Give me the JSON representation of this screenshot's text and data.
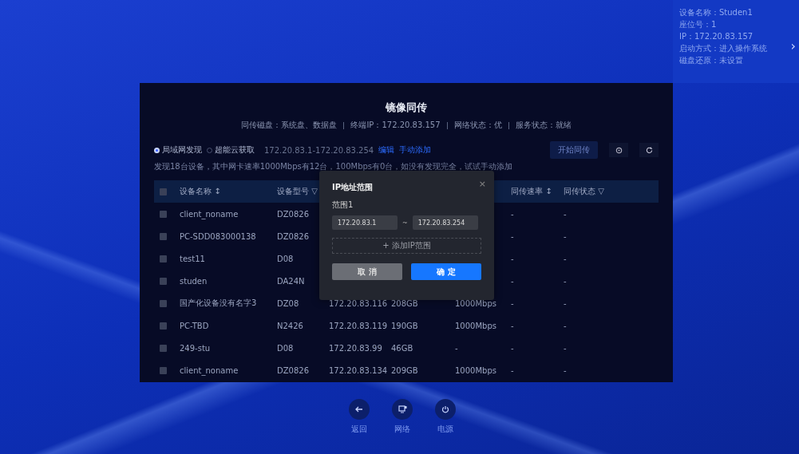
{
  "device_info": {
    "lines": [
      "设备名称：Studen1",
      "座位号：1",
      "IP：172.20.83.157",
      "启动方式：进入操作系统",
      "磁盘还原：未设置"
    ],
    "expand": "›"
  },
  "panel": {
    "title": "镜像同传",
    "status_items": [
      "同传磁盘：系统盘、数据盘",
      "终端IP：172.20.83.157",
      "网络状态：优",
      "服务状态：就绪"
    ],
    "sources": [
      {
        "label": "局域网发现",
        "selected": true
      },
      {
        "label": "超能云获取",
        "selected": false
      }
    ],
    "range": "172.20.83.1-172.20.83.254",
    "links": [
      "编辑",
      "手动添加"
    ],
    "start_button": {
      "label": "开始同传",
      "disabled": true
    },
    "summary": "发现18台设备，其中网卡速率1000Mbps有12台，100Mbps有0台，如没有发现完全，试试手动添加"
  },
  "table": {
    "header_checked": false,
    "columns": [
      {
        "label": "设备名称 ↕"
      },
      {
        "label": "设备型号 ▽"
      },
      {},
      {},
      {},
      {
        "label": "同传速率 ↕"
      },
      {
        "label": "同传状态 ▽"
      }
    ],
    "rows": [
      {
        "checked": false,
        "cells": [
          "client_noname",
          "DZ0826",
          null,
          null,
          null,
          "-",
          "-"
        ]
      },
      {
        "checked": false,
        "cells": [
          "PC-SDD083000138",
          "DZ0826",
          null,
          null,
          null,
          "-",
          "-"
        ]
      },
      {
        "checked": false,
        "cells": [
          "test11",
          "D08",
          null,
          null,
          null,
          "-",
          "-"
        ]
      },
      {
        "checked": false,
        "cells": [
          "studen",
          "DA24N",
          null,
          null,
          null,
          "-",
          "-"
        ]
      },
      {
        "checked": false,
        "cells": [
          "国产化设备没有名字3",
          "DZ08",
          "172.20.83.116",
          "208GB",
          "1000Mbps",
          "-",
          "-"
        ]
      },
      {
        "checked": false,
        "cells": [
          "PC-TBD",
          "N2426",
          "172.20.83.119",
          "190GB",
          "1000Mbps",
          "-",
          "-"
        ]
      },
      {
        "checked": false,
        "cells": [
          "249-stu",
          "D08",
          "172.20.83.99",
          "46GB",
          "-",
          "-",
          "-"
        ]
      },
      {
        "checked": false,
        "cells": [
          "client_noname",
          "DZ0826",
          "172.20.83.134",
          "209GB",
          "1000Mbps",
          "-",
          "-"
        ]
      }
    ]
  },
  "dialog": {
    "title": "IP地址范围",
    "close": "×",
    "range_label": "范围1",
    "from": "172.20.83.1",
    "separator": "~",
    "to": "172.20.83.254",
    "add_button": "+ 添加IP范围",
    "cancel": "取 消",
    "confirm": "确 定"
  },
  "dock": [
    {
      "kind": "back",
      "label": "返回"
    },
    {
      "kind": "network",
      "label": "网络"
    },
    {
      "kind": "power",
      "label": "电源"
    }
  ]
}
